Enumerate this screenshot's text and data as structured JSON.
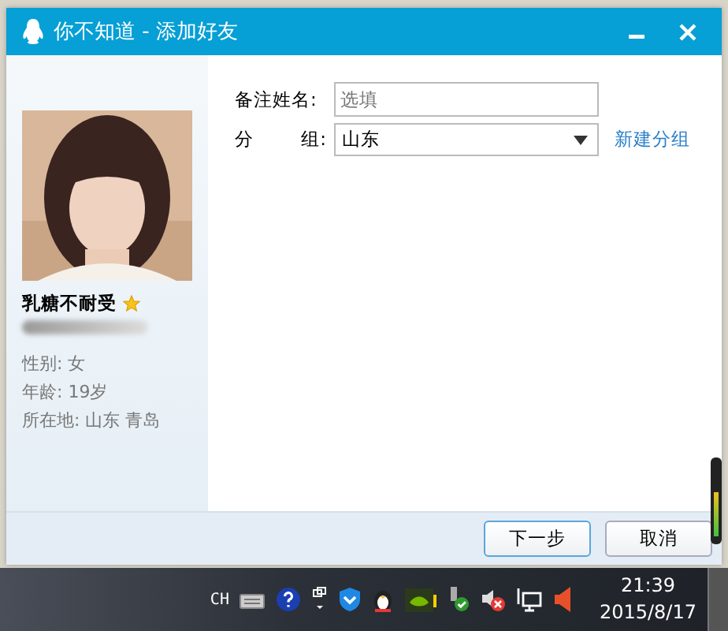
{
  "window": {
    "title": "你不知道 - 添加好友"
  },
  "profile": {
    "nickname": "乳糖不耐受",
    "starred": true,
    "details": [
      "性别: 女",
      "年龄: 19岁",
      "所在地: 山东  青岛"
    ]
  },
  "form": {
    "remark_label": "备注姓名:",
    "remark_placeholder": "选填",
    "group_label_1": "分",
    "group_label_2": "组:",
    "group_value": "山东",
    "new_group_link": "新建分组"
  },
  "buttons": [
    {
      "label": "下一步",
      "selected": true
    },
    {
      "label": "取消",
      "selected": false
    }
  ],
  "taskbar": {
    "language": "CH",
    "time": "21:39",
    "date": "2015/8/17"
  }
}
